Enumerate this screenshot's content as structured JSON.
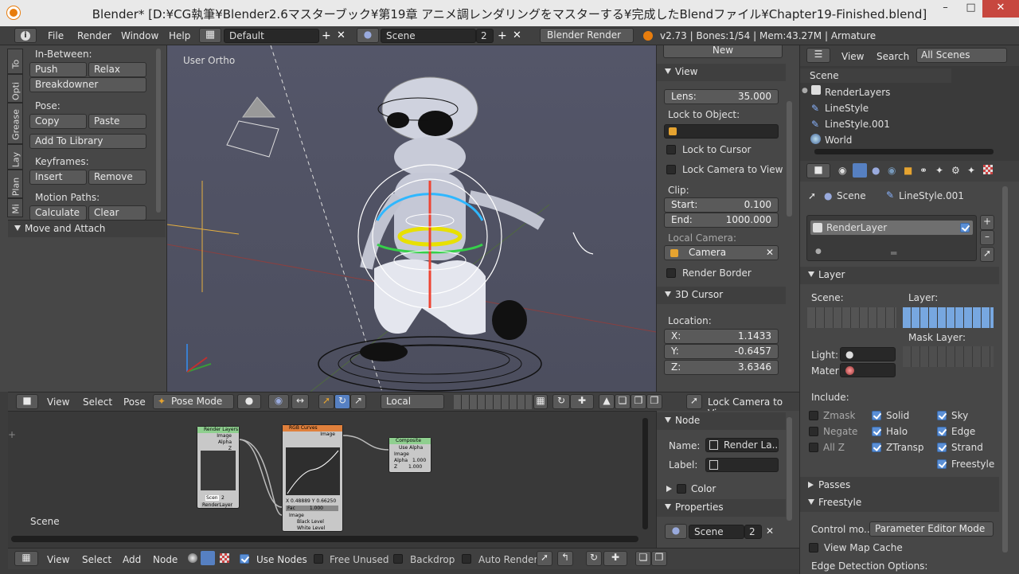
{
  "window": {
    "title": "Blender* [D:¥CG執筆¥Blender2.6マスターブック¥第19章 アニメ調レンダリングをマスターする¥完成したBlendファイル¥Chapter19-Finished.blend]"
  },
  "infobar": {
    "menus": [
      "File",
      "Render",
      "Window",
      "Help"
    ],
    "layout": "Default",
    "scene": "Scene",
    "scene_users": "2",
    "engine": "Blender Render",
    "stats": "v2.73 | Bones:1/54 | Mem:43.27M | Armature"
  },
  "tool_shelf": {
    "tabs": [
      "To",
      "Opti",
      "Grease",
      "Lay",
      "Plan",
      "Mi"
    ],
    "inbetween_label": "In-Between:",
    "push": "Push",
    "relax": "Relax",
    "breakdowner": "Breakdowner",
    "pose_label": "Pose:",
    "copy": "Copy",
    "paste": "Paste",
    "add_library": "Add To Library",
    "keyframes_label": "Keyframes:",
    "insert": "Insert",
    "remove": "Remove",
    "motion_label": "Motion Paths:",
    "calculate": "Calculate",
    "clear": "Clear",
    "move_attach": "Move and Attach"
  },
  "viewport": {
    "label": "User Ortho"
  },
  "view_props": {
    "new": "New",
    "view_header": "View",
    "lens_label": "Lens:",
    "lens_value": "35.000",
    "lock_object": "Lock to Object:",
    "lock_cursor": "Lock to Cursor",
    "lock_camera": "Lock Camera to View",
    "clip": "Clip:",
    "start_label": "Start:",
    "start_value": "0.100",
    "end_label": "End:",
    "end_value": "1000.000",
    "local_camera": "Local Camera:",
    "camera": "Camera",
    "render_border": "Render Border",
    "cursor_header": "3D Cursor",
    "location": "Location:",
    "x_label": "X:",
    "x_value": "1.1433",
    "y_label": "Y:",
    "y_value": "-0.6457",
    "z_label": "Z:",
    "z_value": "3.6346"
  },
  "view3d_header": {
    "view": "View",
    "select": "Select",
    "pose": "Pose",
    "mode": "Pose Mode",
    "orientation": "Local",
    "lock_camera": "Lock Camera to View"
  },
  "outliner": {
    "view": "View",
    "search": "Search",
    "filter": "All Scenes",
    "items": [
      "Scene",
      "RenderLayers",
      "LineStyle",
      "LineStyle.001",
      "World"
    ]
  },
  "properties": {
    "breadcrumb_scene": "Scene",
    "breadcrumb_style": "LineStyle.001",
    "renderlayer": "RenderLayer",
    "layer_header": "Layer",
    "scene_label": "Scene:",
    "layer_label": "Layer:",
    "mask_layer": "Mask Layer:",
    "light": "Light:",
    "mater": "Mater",
    "include": "Include:",
    "zmask": "Zmask",
    "solid": "Solid",
    "sky": "Sky",
    "negate": "Negate",
    "halo": "Halo",
    "edge": "Edge",
    "allz": "All Z",
    "ztransp": "ZTransp",
    "strand": "Strand",
    "freestyle": "Freestyle",
    "passes": "Passes",
    "freestyle_header": "Freestyle",
    "control_label": "Control mo...",
    "control_value": "Parameter Editor Mode",
    "view_map_cache": "View Map Cache",
    "edge_detection": "Edge Detection Options:"
  },
  "node_editor": {
    "scene_label": "Scene",
    "render_layers": {
      "title": "Render Layers",
      "out1": "Image",
      "out2": "Alpha",
      "out3": "Z",
      "scene": "Scen",
      "users": "2",
      "layer": "RenderLayer"
    },
    "rgb_curves": {
      "title": "RGB Curves",
      "image_out": "Image",
      "x": "X 0.48889",
      "y": "Y 0.66250",
      "fac": "Fac",
      "fac_val": "1.000",
      "image_in": "Image",
      "black": "Black Level",
      "white": "White Level"
    },
    "composite": {
      "title": "Composite",
      "use_alpha": "Use Alpha",
      "image": "Image",
      "alpha": "Alpha",
      "alpha_val": "1.000",
      "z": "Z",
      "z_val": "1.000"
    }
  },
  "node_props": {
    "node_header": "Node",
    "name_label": "Name:",
    "name_value": "Render La...",
    "label_label": "Label:",
    "color": "Color",
    "properties": "Properties",
    "scene": "Scene",
    "users": "2"
  },
  "node_header": {
    "view": "View",
    "select": "Select",
    "add": "Add",
    "node": "Node",
    "use_nodes": "Use Nodes",
    "free_unused": "Free Unused",
    "backdrop": "Backdrop",
    "auto_render": "Auto Render"
  }
}
